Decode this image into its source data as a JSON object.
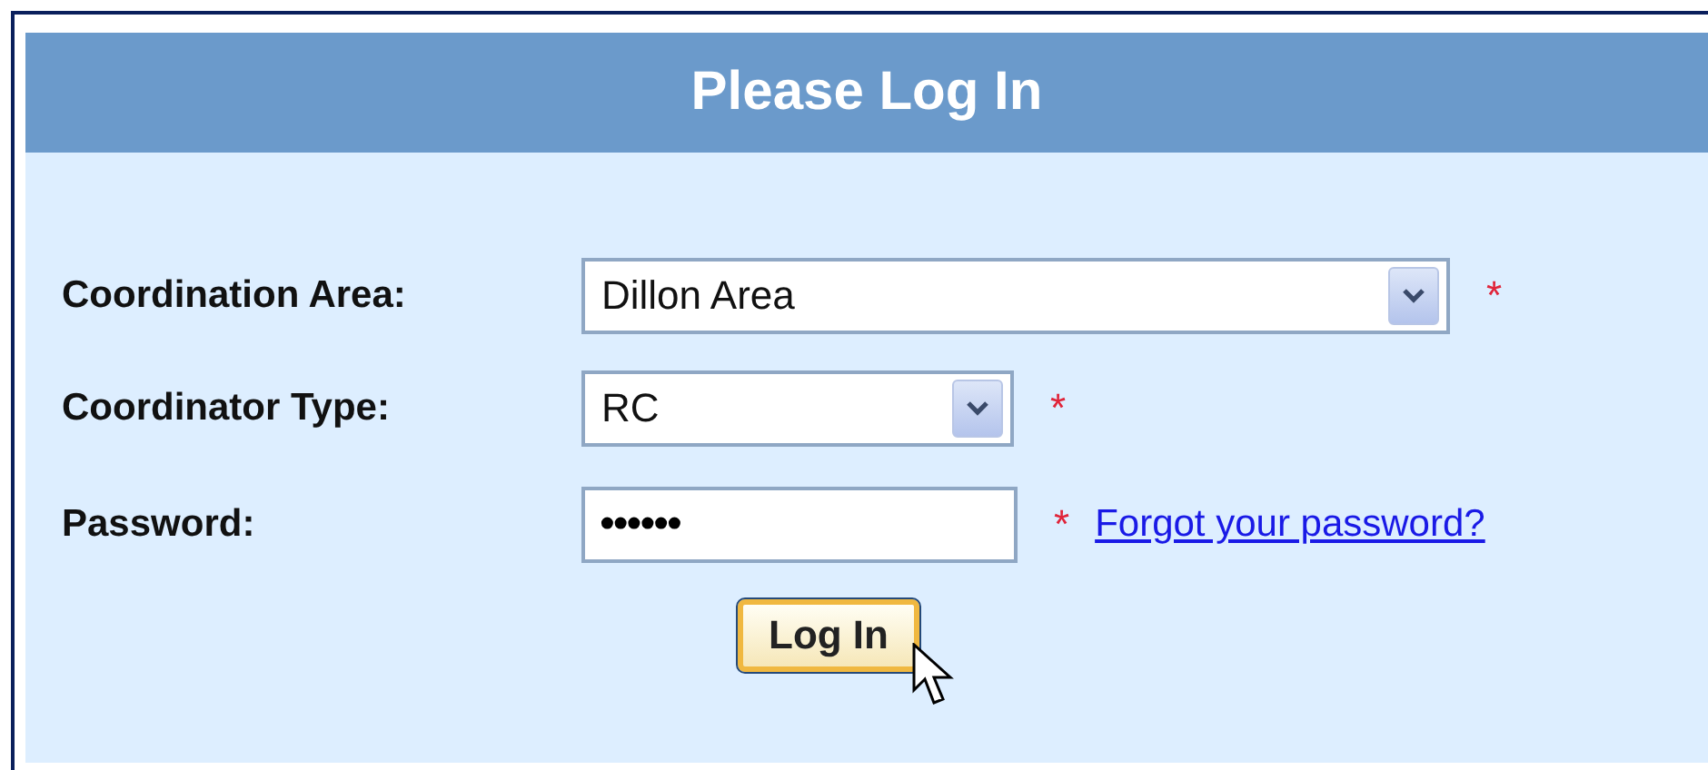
{
  "title": "Please Log In",
  "fields": [
    {
      "kind": "select",
      "label": "Coordination Area:",
      "value": "Dillon Area",
      "required": true
    },
    {
      "kind": "select",
      "label": "Coordinator Type:",
      "value": "RC",
      "required": true
    },
    {
      "kind": "password",
      "label": "Password:",
      "value": "••••••",
      "required": true,
      "link": "Forgot your password?"
    }
  ],
  "required_mark": "*",
  "button": "Log In"
}
